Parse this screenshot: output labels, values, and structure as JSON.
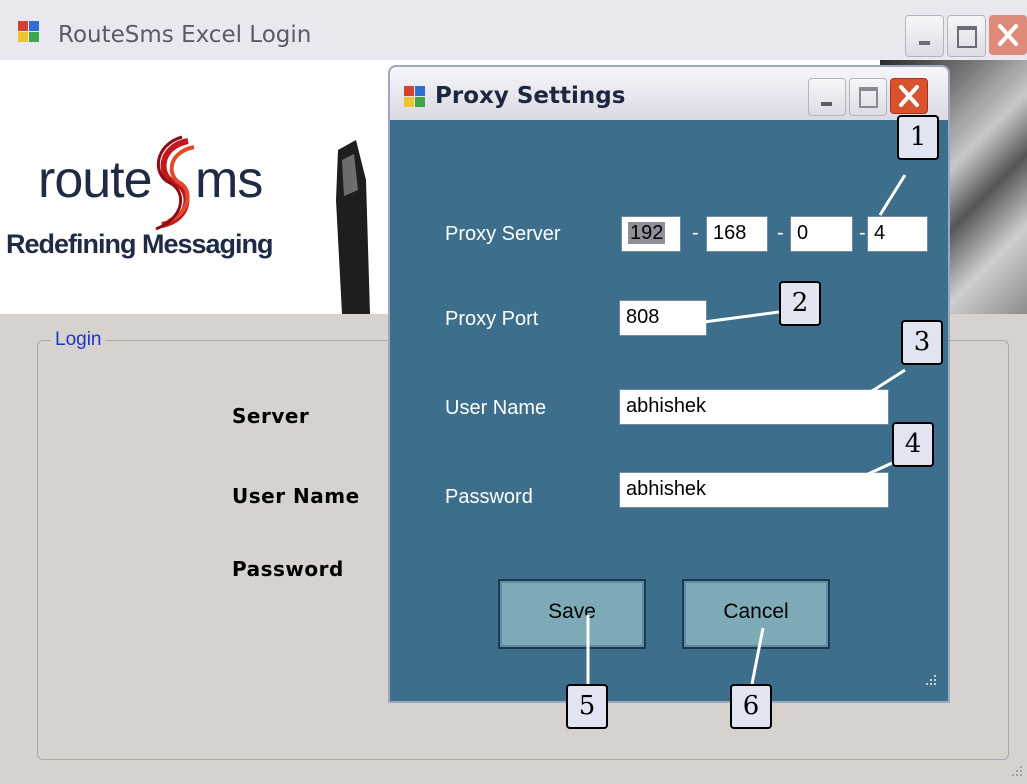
{
  "main_window": {
    "title": "RouteSms Excel Login",
    "banner": {
      "logo_prefix": "route",
      "logo_suffix": "ms",
      "tagline": "Redefining Messaging"
    },
    "login_group": {
      "legend": "Login",
      "labels": {
        "server": "Server",
        "user_name": "User Name",
        "password": "Password"
      }
    }
  },
  "proxy_dialog": {
    "title": "Proxy Settings",
    "labels": {
      "proxy_server": "Proxy Server",
      "proxy_port": "Proxy Port",
      "user_name": "User Name",
      "password": "Password"
    },
    "ip_octets": [
      "192",
      "168",
      "0",
      "4"
    ],
    "ip_separator": "-",
    "proxy_port": "808",
    "user_name": "abhishek",
    "password": "abhishek",
    "buttons": {
      "save": "Save",
      "cancel": "Cancel"
    }
  },
  "callouts": [
    "1",
    "2",
    "3",
    "4",
    "5",
    "6"
  ],
  "colors": {
    "dialog_bg": "#3d6e8c",
    "button_bg": "#7eaab8",
    "legend_text": "#1f35c8",
    "close_red": "#d9522d"
  }
}
